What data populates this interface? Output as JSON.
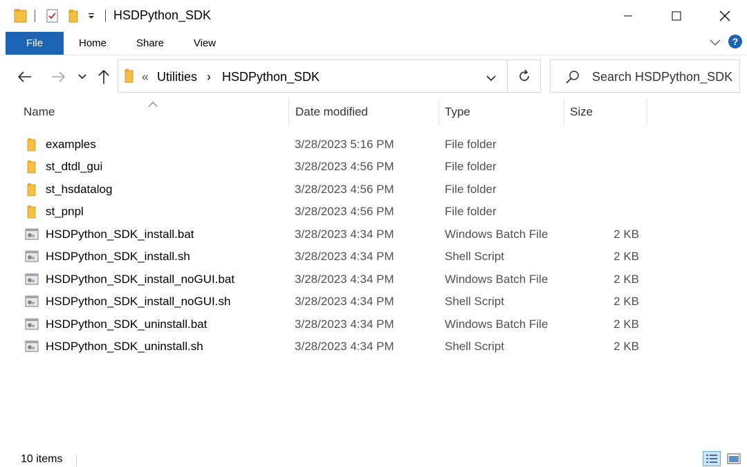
{
  "window": {
    "title": "HSDPython_SDK",
    "controls": [
      "minimize",
      "maximize",
      "close"
    ]
  },
  "ribbon": {
    "tabs": [
      {
        "label": "File"
      },
      {
        "label": "Home"
      },
      {
        "label": "Share"
      },
      {
        "label": "View"
      }
    ],
    "help": "?"
  },
  "address": {
    "overflow": "«",
    "segments": [
      "Utilities",
      "HSDPython_SDK"
    ],
    "separator": "›"
  },
  "search": {
    "placeholder": "Search HSDPython_SDK"
  },
  "columns": {
    "name": "Name",
    "date": "Date modified",
    "type": "Type",
    "size": "Size"
  },
  "files": [
    {
      "name": "examples",
      "date": "3/28/2023 5:16 PM",
      "type": "File folder",
      "size": "",
      "icon": "folder-icon"
    },
    {
      "name": "st_dtdl_gui",
      "date": "3/28/2023 4:56 PM",
      "type": "File folder",
      "size": "",
      "icon": "folder-icon"
    },
    {
      "name": "st_hsdatalog",
      "date": "3/28/2023 4:56 PM",
      "type": "File folder",
      "size": "",
      "icon": "folder-icon"
    },
    {
      "name": "st_pnpl",
      "date": "3/28/2023 4:56 PM",
      "type": "File folder",
      "size": "",
      "icon": "folder-icon"
    },
    {
      "name": "HSDPython_SDK_install.bat",
      "date": "3/28/2023 4:34 PM",
      "type": "Windows Batch File",
      "size": "2 KB",
      "icon": "batch-file-icon"
    },
    {
      "name": "HSDPython_SDK_install.sh",
      "date": "3/28/2023 4:34 PM",
      "type": "Shell Script",
      "size": "2 KB",
      "icon": "script-file-icon"
    },
    {
      "name": "HSDPython_SDK_install_noGUI.bat",
      "date": "3/28/2023 4:34 PM",
      "type": "Windows Batch File",
      "size": "2 KB",
      "icon": "batch-file-icon"
    },
    {
      "name": "HSDPython_SDK_install_noGUI.sh",
      "date": "3/28/2023 4:34 PM",
      "type": "Shell Script",
      "size": "2 KB",
      "icon": "script-file-icon"
    },
    {
      "name": "HSDPython_SDK_uninstall.bat",
      "date": "3/28/2023 4:34 PM",
      "type": "Windows Batch File",
      "size": "2 KB",
      "icon": "batch-file-icon"
    },
    {
      "name": "HSDPython_SDK_uninstall.sh",
      "date": "3/28/2023 4:34 PM",
      "type": "Shell Script",
      "size": "2 KB",
      "icon": "script-file-icon"
    }
  ],
  "status": {
    "item_count": "10 items"
  },
  "colors": {
    "file_tab": "#1e64b4",
    "folder": "#f4c044",
    "help": "#1e64b4"
  }
}
